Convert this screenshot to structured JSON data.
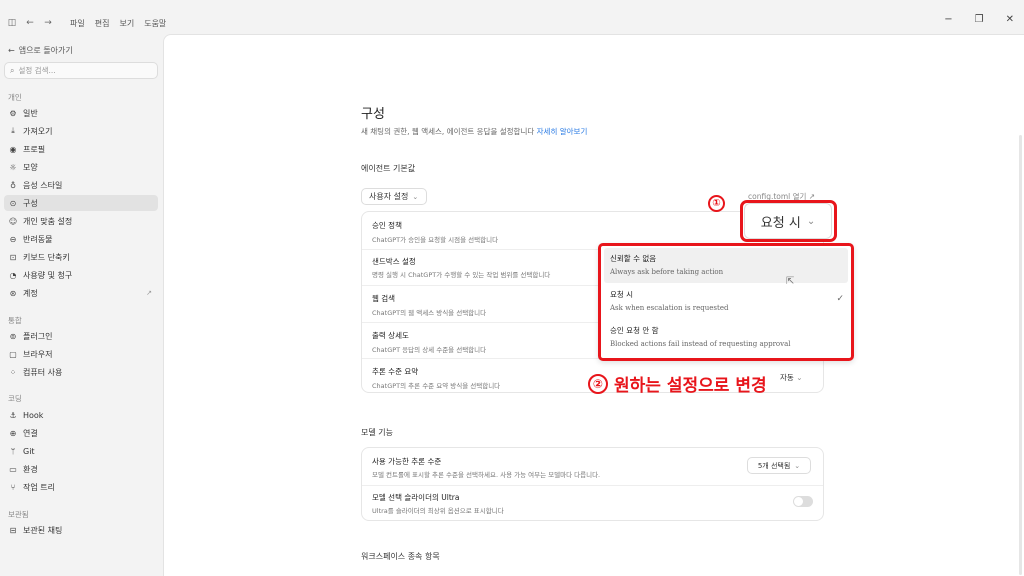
{
  "titlebar": {
    "menus": [
      "파일",
      "편집",
      "보기",
      "도움말"
    ],
    "window_controls": [
      "minimize-icon",
      "restore-icon",
      "close-icon"
    ]
  },
  "sidebar": {
    "back_label": "앱으로 돌아가기",
    "search_placeholder": "설정 검색...",
    "sections": {
      "personal": "개인",
      "integration": "통합",
      "coding": "코딩",
      "archive": "보관됨"
    },
    "personal_items": [
      {
        "label": "일반",
        "icon": "gear-icon"
      },
      {
        "label": "가져오기",
        "icon": "download-icon"
      },
      {
        "label": "프로필",
        "icon": "user-icon"
      },
      {
        "label": "모양",
        "icon": "sun-icon"
      },
      {
        "label": "음성 스타일",
        "icon": "mic-icon"
      },
      {
        "label": "구성",
        "icon": "config-icon",
        "active": true
      },
      {
        "label": "개인 맞춤 설정",
        "icon": "personalize-icon"
      },
      {
        "label": "반려동물",
        "icon": "pet-icon"
      },
      {
        "label": "키보드 단축키",
        "icon": "keyboard-icon"
      },
      {
        "label": "사용량 및 청구",
        "icon": "usage-icon"
      },
      {
        "label": "계정",
        "icon": "account-icon",
        "external": true
      }
    ],
    "integration_items": [
      {
        "label": "플러그인",
        "icon": "plugin-icon"
      },
      {
        "label": "브라우저",
        "icon": "browser-icon"
      },
      {
        "label": "컴퓨터 사용",
        "icon": "computer-use-icon"
      }
    ],
    "coding_items": [
      {
        "label": "Hook",
        "icon": "hook-icon"
      },
      {
        "label": "연결",
        "icon": "globe-icon"
      },
      {
        "label": "Git",
        "icon": "git-icon"
      },
      {
        "label": "환경",
        "icon": "monitor-icon"
      },
      {
        "label": "작업 트리",
        "icon": "worktree-icon"
      }
    ],
    "archive_items": [
      {
        "label": "보관된 채팅",
        "icon": "archive-icon"
      }
    ]
  },
  "main": {
    "title": "구성",
    "description": "새 채팅의 권한, 웹 액세스, 에이전트 응답을 설정합니다",
    "learn_more": "자세히 알아보기",
    "agent_defaults_heading": "에이전트 기본값",
    "scope_dropdown": "사용자 설정",
    "config_link": "config.toml 열기 ↗",
    "agent_rows": [
      {
        "title": "승인 정책",
        "desc": "ChatGPT가 승인을 요청할 시점을 선택합니다"
      },
      {
        "title": "샌드박스 설정",
        "desc": "명령 실행 시 ChatGPT가 수행할 수 있는 작업 범위를 선택합니다"
      },
      {
        "title": "웹 검색",
        "desc": "ChatGPT의 웹 액세스 방식을 선택합니다"
      },
      {
        "title": "출력 상세도",
        "desc": "ChatGPT 응답의 상세 수준을 선택합니다"
      },
      {
        "title": "추론 수준 요약",
        "desc": "ChatGPT의 추론 수준 요약 방식을 선택합니다",
        "value": "자동"
      }
    ],
    "approval_select_value": "요청 시",
    "model_heading": "모델 기능",
    "model_rows": [
      {
        "title": "사용 가능한 추론 수준",
        "desc": "모델 컨트롤에 표시할 추론 수준을 선택하세요. 사용 가능 여부는 모델마다 다릅니다.",
        "value": "5개 선택됨"
      },
      {
        "title": "모델 선택 슬라이더의 Ultra",
        "desc": "Ultra를 슬라이더의 최상위 옵션으로 표시합니다"
      }
    ],
    "workspace_heading": "워크스페이스 종속 항목"
  },
  "dropdown_options": [
    {
      "title": "신뢰할 수 없음",
      "desc": "Always ask before taking action",
      "hover": true
    },
    {
      "title": "요청 시",
      "desc": "Ask when escalation is requested",
      "selected": true
    },
    {
      "title": "승인 요청 안 함",
      "desc": "Blocked actions fail instead of requesting approval"
    }
  ],
  "annotations": {
    "step1": "①",
    "step2": "②",
    "step2_text": "원하는 설정으로 변경",
    "color": "#e8151b"
  },
  "colors": {
    "accent_link": "#2a7be4",
    "annotation_red": "#e8151b"
  }
}
